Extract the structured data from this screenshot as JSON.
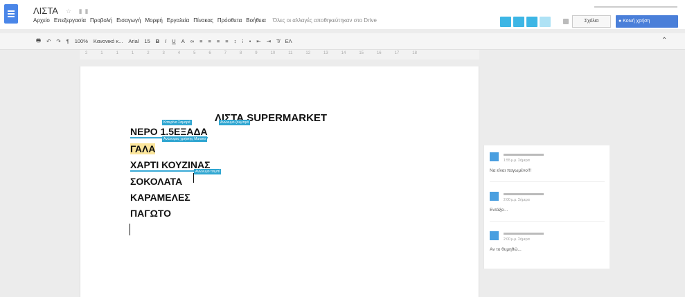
{
  "header": {
    "title": "ΛΙΣΤΑ",
    "title_icons": "☆ ▮▮",
    "menu": [
      "Αρχείο",
      "Επεξεργασία",
      "Προβολή",
      "Εισαγωγή",
      "Μορφή",
      "Εργαλεία",
      "Πίνακας",
      "Πρόσθετα",
      "Βοήθεια"
    ],
    "saved_status": "Όλες οι αλλαγές αποθηκεύτηκαν στο Drive",
    "comments_button": "Σχόλια",
    "share_button": "Κοινή χρήση",
    "accent": "#4a86e8"
  },
  "toolbar": {
    "zoom": "100%",
    "style": "Κανονικό κ...",
    "font": "Arial",
    "size": "15",
    "extra": "ΕΛ"
  },
  "ruler": [
    "2",
    "1",
    "1",
    "1",
    "2",
    "3",
    "4",
    "5",
    "6",
    "7",
    "8",
    "9",
    "10",
    "11",
    "12",
    "13",
    "14",
    "15",
    "16",
    "17",
    "18"
  ],
  "document": {
    "title": "ΛΙΣΤΑ SUPERMARKET",
    "lines": [
      "ΝΕΡΟ 1.5ΕΞΑΔΑ",
      "ΓΑΛΑ",
      "ΧΑΡΤΙ ΚΟΥΖΙΝΑΣ",
      "ΣΟΚΟΛΑΤΑ",
      "ΚΑΡΑΜΕΛΕΣ",
      "ΠΑΓΩΤΟ"
    ],
    "tags": [
      "Κατερίνα Σαμαρά",
      "Ανώνυμο ζουμπρό",
      "Ανώνυμος χρήστης Murano",
      "Ανώνυμο τσιμπί"
    ],
    "highlight": "#fbe59b",
    "collab_color": "#2fa6d1"
  },
  "comments": [
    {
      "time": "1:55 μ.μ. Σήμερα",
      "text": "Να είναι παγωμένο!!!"
    },
    {
      "time": "2:00 μ.μ. Σήμερα",
      "text": "Εντάξει..."
    },
    {
      "time": "2:00 μ.μ. Σήμερα",
      "text": "Αν το θυμηθώ..."
    }
  ]
}
